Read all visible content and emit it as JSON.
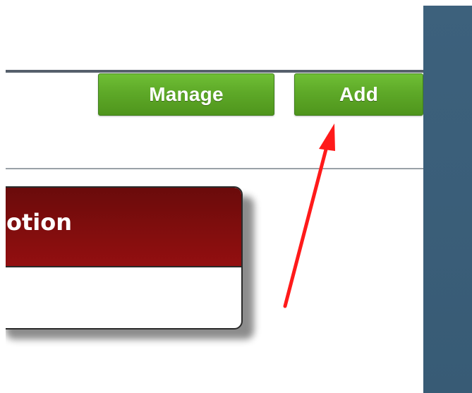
{
  "toolbar": {
    "manage_label": "Manage",
    "add_label": "Add"
  },
  "card": {
    "title_partial": "otion"
  },
  "annotations": {
    "arrow_color": "#ff1a1a"
  },
  "colors": {
    "button_green": "#5ea928",
    "card_header_red": "#7d0d0d",
    "right_panel_blue": "#3b5f7a"
  },
  "icons": {
    "annotation": "red-arrow-icon"
  }
}
